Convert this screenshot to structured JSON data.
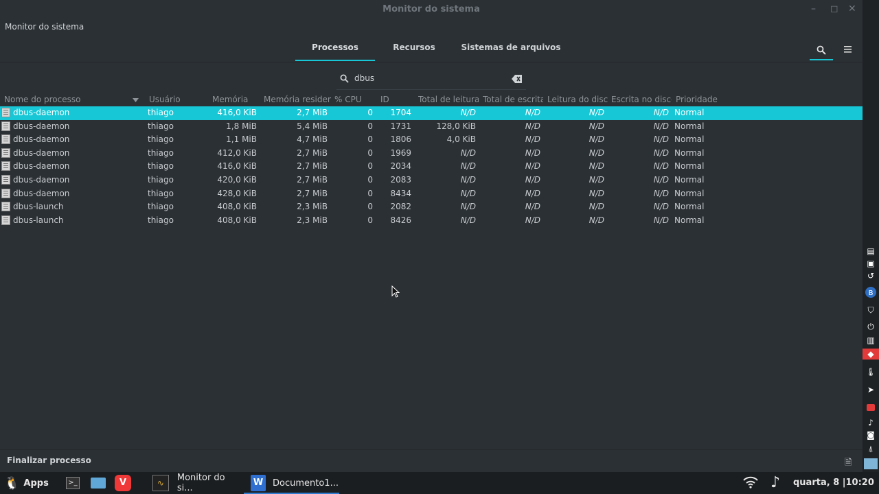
{
  "window": {
    "title": "Monitor do sistema",
    "app_label": "Monitor do sistema"
  },
  "tabs": [
    "Processos",
    "Recursos",
    "Sistemas de arquivos"
  ],
  "search": {
    "query": "dbus"
  },
  "columns": [
    "Nome do processo",
    "Usuário",
    "Memória",
    "Memória resident",
    "% CPU",
    "ID",
    "Total de leitura",
    "Total de escrita",
    "Leitura do disco",
    "Escrita no disco",
    "Prioridade"
  ],
  "processes": [
    {
      "name": "dbus-daemon",
      "user": "thiago",
      "mem": "416,0 KiB",
      "res": "2,7 MiB",
      "cpu": "0",
      "id": "1704",
      "tread": "N/D",
      "twrite": "N/D",
      "dread": "N/D",
      "dwrite": "N/D",
      "prio": "Normal"
    },
    {
      "name": "dbus-daemon",
      "user": "thiago",
      "mem": "1,8 MiB",
      "res": "5,4 MiB",
      "cpu": "0",
      "id": "1731",
      "tread": "128,0 KiB",
      "twrite": "N/D",
      "dread": "N/D",
      "dwrite": "N/D",
      "prio": "Normal"
    },
    {
      "name": "dbus-daemon",
      "user": "thiago",
      "mem": "1,1 MiB",
      "res": "4,7 MiB",
      "cpu": "0",
      "id": "1806",
      "tread": "4,0 KiB",
      "twrite": "N/D",
      "dread": "N/D",
      "dwrite": "N/D",
      "prio": "Normal"
    },
    {
      "name": "dbus-daemon",
      "user": "thiago",
      "mem": "412,0 KiB",
      "res": "2,7 MiB",
      "cpu": "0",
      "id": "1969",
      "tread": "N/D",
      "twrite": "N/D",
      "dread": "N/D",
      "dwrite": "N/D",
      "prio": "Normal"
    },
    {
      "name": "dbus-daemon",
      "user": "thiago",
      "mem": "416,0 KiB",
      "res": "2,7 MiB",
      "cpu": "0",
      "id": "2034",
      "tread": "N/D",
      "twrite": "N/D",
      "dread": "N/D",
      "dwrite": "N/D",
      "prio": "Normal"
    },
    {
      "name": "dbus-daemon",
      "user": "thiago",
      "mem": "420,0 KiB",
      "res": "2,7 MiB",
      "cpu": "0",
      "id": "2083",
      "tread": "N/D",
      "twrite": "N/D",
      "dread": "N/D",
      "dwrite": "N/D",
      "prio": "Normal"
    },
    {
      "name": "dbus-daemon",
      "user": "thiago",
      "mem": "428,0 KiB",
      "res": "2,7 MiB",
      "cpu": "0",
      "id": "8434",
      "tread": "N/D",
      "twrite": "N/D",
      "dread": "N/D",
      "dwrite": "N/D",
      "prio": "Normal"
    },
    {
      "name": "dbus-launch",
      "user": "thiago",
      "mem": "408,0 KiB",
      "res": "2,3 MiB",
      "cpu": "0",
      "id": "2082",
      "tread": "N/D",
      "twrite": "N/D",
      "dread": "N/D",
      "dwrite": "N/D",
      "prio": "Normal"
    },
    {
      "name": "dbus-launch",
      "user": "thiago",
      "mem": "408,0 KiB",
      "res": "2,3 MiB",
      "cpu": "0",
      "id": "8426",
      "tread": "N/D",
      "twrite": "N/D",
      "dread": "N/D",
      "dwrite": "N/D",
      "prio": "Normal"
    }
  ],
  "selected_row": 0,
  "footer": {
    "kill_label": "Finalizar processo"
  },
  "taskbar": {
    "apps_label": "Apps",
    "tasks": [
      "Monitor do si...",
      "Documento1..."
    ],
    "clock": "quarta,  8 |10:20"
  },
  "colors": {
    "accent": "#17c7d6",
    "background": "#2b3034",
    "taskbar": "#1b1e20"
  },
  "side_icons": [
    "clipboard-icon",
    "screenshot-icon",
    "undo-icon",
    "bluetooth-icon",
    "shield-icon",
    "power-icon",
    "trash-icon",
    "anydesk-icon",
    "thermometer-icon",
    "send-icon",
    "record-icon",
    "bell-icon",
    "photo-icon",
    "tree-icon"
  ]
}
